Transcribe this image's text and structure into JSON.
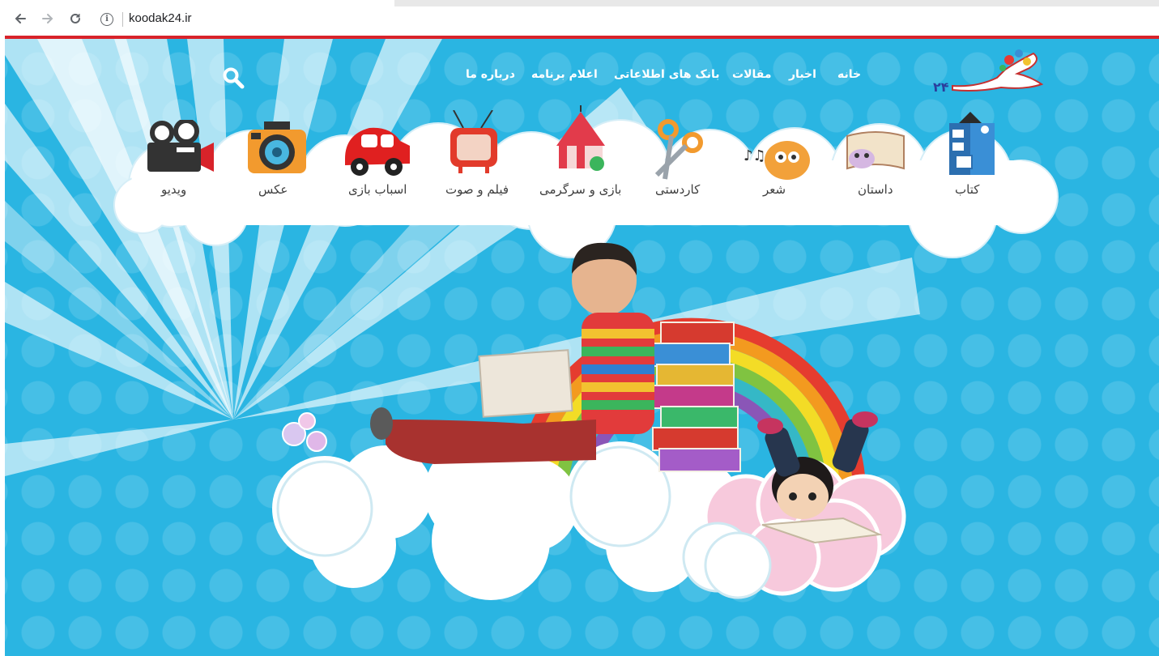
{
  "browser": {
    "url": "koodak24.ir",
    "back_icon": "arrow-left-icon",
    "forward_icon": "arrow-right-icon",
    "reload_icon": "reload-icon",
    "info_icon": "info-icon"
  },
  "site": {
    "logo_number": "۲۴",
    "nav": [
      "خانه",
      "اخبار",
      "مقالات",
      "بانک های اطلاعاتی",
      "اعلام برنامه",
      "درباره ما"
    ],
    "categories": [
      "کتاب",
      "داستان",
      "شعر",
      "کاردستی",
      "بازی و سرگرمی",
      "فیلم و صوت",
      "اسباب بازی",
      "عکس",
      "ویدیو"
    ]
  },
  "colors": {
    "accent_red": "#d8232a",
    "sky_blue": "#2ab5e2",
    "cloud_white": "#ffffff"
  }
}
